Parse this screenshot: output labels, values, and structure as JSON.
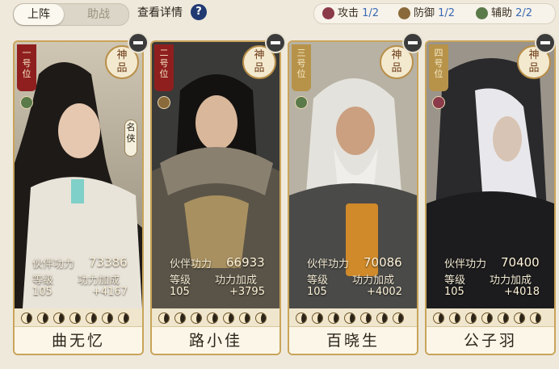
{
  "tabs": {
    "active": "上阵",
    "inactive": "助战"
  },
  "detail_label": "查看详情",
  "help_icon": "?",
  "roles": [
    {
      "name": "攻击",
      "count": "1/2",
      "icon": "attack-icon",
      "color": "#8b3a4a"
    },
    {
      "name": "防御",
      "count": "1/2",
      "icon": "defense-icon",
      "color": "#8a6a3a"
    },
    {
      "name": "辅助",
      "count": "2/2",
      "icon": "support-icon",
      "color": "#5a7a4a"
    }
  ],
  "grade_label": "神\n品",
  "stat_labels": {
    "power": "伙伴功力",
    "level": "等级",
    "bonus": "功力加成"
  },
  "cards": [
    {
      "slot": "一\n号\n位",
      "name": "曲无忆",
      "power": "73386",
      "level": "105",
      "bonus": "+4167",
      "role": "support",
      "title": "名\n侠",
      "ribbon_color": "#8f1f1f",
      "role_color": "#5a7a4a"
    },
    {
      "slot": "二\n号\n位",
      "name": "路小佳",
      "power": "66933",
      "level": "105",
      "bonus": "+3795",
      "role": "defense",
      "ribbon_color": "#8f1f1f",
      "role_color": "#8a6a3a"
    },
    {
      "slot": "三\n号\n位",
      "name": "百晓生",
      "power": "70086",
      "level": "105",
      "bonus": "+4002",
      "role": "support",
      "ribbon_color": "#b7934a",
      "role_color": "#5a7a4a"
    },
    {
      "slot": "四\n号\n位",
      "name": "公子羽",
      "power": "70400",
      "level": "105",
      "bonus": "+4018",
      "role": "attack",
      "ribbon_color": "#b7934a",
      "role_color": "#8b3a4a"
    }
  ]
}
